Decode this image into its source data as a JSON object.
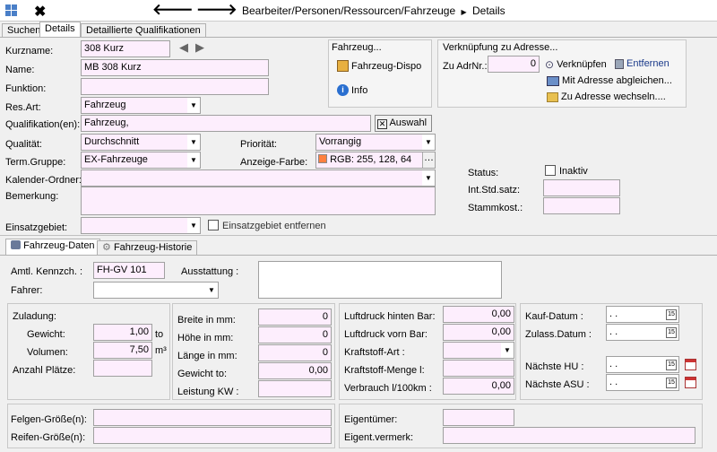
{
  "toolbar": {
    "breadcrumb": "Bearbeiter/Personen/Ressourcen/Fahrzeuge",
    "current": "Details"
  },
  "tabs": [
    "Suchen",
    "Details",
    "Detaillierte Qualifikationen"
  ],
  "form": {
    "kurzname_label": "Kurzname:",
    "kurzname": "308 Kurz",
    "name_label": "Name:",
    "name": "MB 308 Kurz",
    "funktion_label": "Funktion:",
    "funktion": "",
    "resart_label": "Res.Art:",
    "resart": "Fahrzeug",
    "qualifikation_label": "Qualifikation(en):",
    "qualifikation": "Fahrzeug,",
    "auswahl": "Auswahl",
    "qualitaet_label": "Qualität:",
    "qualitaet": "Durchschnitt",
    "termgruppe_label": "Term.Gruppe:",
    "termgruppe": "EX-Fahrzeuge",
    "kalender_label": "Kalender-Ordner:",
    "kalender": "",
    "bemerkung_label": "Bemerkung:",
    "bemerkung": "",
    "einsatzgebiet_label": "Einsatzgebiet:",
    "einsatzgebiet": "",
    "einsatzgebiet_entfernen": "Einsatzgebiet entfernen",
    "prioritaet_label": "Priorität:",
    "prioritaet": "Vorrangig",
    "anzeigefarbe_label": "Anzeige-Farbe:",
    "anzeigefarbe": "RGB: 255, 128, 64",
    "anzeigefarbe_color": "#ff8040",
    "status_label": "Status:",
    "inaktiv": "Inaktiv",
    "intstdsatz_label": "Int.Std.satz:",
    "intstdsatz": "",
    "stammkost_label": "Stammkost.:",
    "stammkost": ""
  },
  "fahrzeug_group": {
    "title": "Fahrzeug...",
    "dispo": "Fahrzeug-Dispo",
    "info": "Info"
  },
  "verknuepfung_group": {
    "title": "Verknüpfung zu Adresse...",
    "adrnr_label": "Zu AdrNr.:",
    "adrnr": "0",
    "verknuepfen": "Verknüpfen",
    "entfernen": "Entfernen",
    "abgleichen": "Mit Adresse abgleichen...",
    "wechseln": "Zu Adresse wechseln...."
  },
  "subtabs": [
    "Fahrzeug-Daten",
    "Fahrzeug-Historie"
  ],
  "fzdaten": {
    "kennz_label": "Amtl. Kennzch. :",
    "kennz": "FH-GV 101",
    "ausstattung_label": "Ausstattung :",
    "ausstattung": "",
    "fahrer_label": "Fahrer:",
    "fahrer": "",
    "zuladung_label": "Zuladung:",
    "gewicht_label": "Gewicht:",
    "gewicht": "1,00",
    "gewicht_unit": "to",
    "volumen_label": "Volumen:",
    "volumen": "7,50",
    "volumen_unit": "m³",
    "plaetze_label": "Anzahl Plätze:",
    "plaetze": "",
    "breite_label": "Breite in mm:",
    "breite": "0",
    "hoehe_label": "Höhe in mm:",
    "hoehe": "0",
    "laenge_label": "Länge in mm:",
    "laenge": "0",
    "gewichtto_label": "Gewicht to:",
    "gewichtto": "0,00",
    "leistung_label": "Leistung KW :",
    "leistung": "",
    "lufth_label": "Luftdruck hinten Bar:",
    "lufth": "0,00",
    "luftv_label": "Luftdruck vorn Bar:",
    "luftv": "0,00",
    "kraftstoff_label": "Kraftstoff-Art :",
    "kraftstoff": "",
    "kraftmenge_label": "Kraftstoff-Menge l:",
    "kraftmenge": "",
    "verbrauch_label": "Verbrauch l/100km :",
    "verbrauch": "0,00",
    "kauf_label": "Kauf-Datum :",
    "kauf": " .  .",
    "zulass_label": "Zulass.Datum :",
    "zulass": " .  .",
    "hu_label": "Nächste HU :",
    "hu": " .  .",
    "asu_label": "Nächste ASU :",
    "asu": " .  .",
    "felgen_label": "Felgen-Größe(n):",
    "felgen": "",
    "reifen_label": "Reifen-Größe(n):",
    "reifen": "",
    "eigentuemer_label": "Eigentümer:",
    "eigentuemer": "",
    "eigentvermerk_label": "Eigent.vermerk:",
    "eigentvermerk": ""
  }
}
